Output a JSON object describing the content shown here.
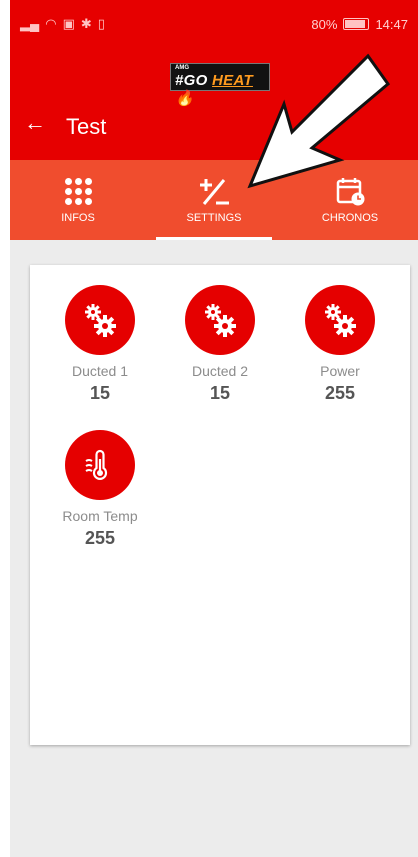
{
  "status": {
    "left_icons": [
      "signal-icon",
      "wifi-icon",
      "nfc-icon",
      "bluetooth-icon",
      "vibrate-icon"
    ],
    "battery": "80%",
    "time": "14:47"
  },
  "logo": {
    "small": "AMG",
    "main_a": "#GO ",
    "main_b": "HEAT"
  },
  "header": {
    "title": "Test"
  },
  "tabs": [
    {
      "label": "INFOS"
    },
    {
      "label": "SETTINGS"
    },
    {
      "label": "CHRONOS"
    }
  ],
  "tiles": [
    {
      "label": "Ducted 1",
      "value": "15",
      "icon": "gears-icon"
    },
    {
      "label": "Ducted 2",
      "value": "15",
      "icon": "gears-icon"
    },
    {
      "label": "Power",
      "value": "255",
      "icon": "gears-icon"
    },
    {
      "label": "Room Temp",
      "value": "255",
      "icon": "thermometer-icon"
    }
  ],
  "colors": {
    "primary": "#e60000",
    "tabbar": "#f04d2e",
    "tile": "#e50000"
  }
}
